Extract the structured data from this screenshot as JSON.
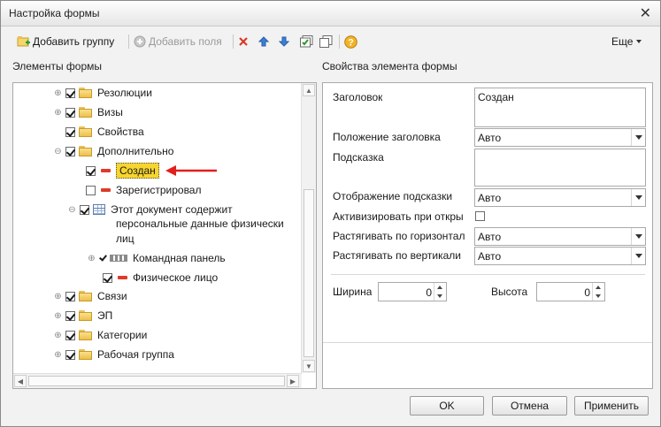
{
  "window": {
    "title": "Настройка формы",
    "close_glyph": "✕"
  },
  "toolbar": {
    "add_group": "Добавить группу",
    "add_fields": "Добавить поля",
    "more": "Еще",
    "icons": [
      "add-group-icon",
      "add-fields-icon",
      "delete-icon",
      "move-up-icon",
      "move-down-icon",
      "check-all-icon",
      "copy-icon",
      "help-icon"
    ]
  },
  "left_panel": {
    "title": "Элементы формы"
  },
  "right_panel": {
    "title": "Свойства элемента формы"
  },
  "tree": {
    "items": [
      {
        "label": "Резолюции",
        "checked": true
      },
      {
        "label": "Визы",
        "checked": true
      },
      {
        "label": "Свойства",
        "checked": true
      },
      {
        "label": "Дополнительно",
        "checked": true
      },
      {
        "label": "Создан",
        "checked": true,
        "selected": true
      },
      {
        "label": "Зарегистрировал",
        "checked": false
      },
      {
        "label": "Этот документ содержит",
        "label2": "персональные данные физически",
        "label3": "лиц",
        "checked": true
      },
      {
        "label": "Командная панель",
        "checked": true
      },
      {
        "label": "Физическое лицо",
        "checked": true
      },
      {
        "label": "Связи",
        "checked": true
      },
      {
        "label": "ЭП",
        "checked": true
      },
      {
        "label": "Категории",
        "checked": true
      },
      {
        "label": "Рабочая группа",
        "checked": true
      }
    ]
  },
  "properties": {
    "title_label": "Заголовок",
    "title_value": "Создан",
    "title_pos_label": "Положение заголовка",
    "title_pos_value": "Авто",
    "hint_label": "Подсказка",
    "hint_value": "",
    "hint_display_label": "Отображение подсказки",
    "hint_display_value": "Авто",
    "activate_label": "Активизировать при откры",
    "activate_checked": false,
    "stretch_h_label": "Растягивать по горизонтал",
    "stretch_h_value": "Авто",
    "stretch_v_label": "Растягивать по вертикали",
    "stretch_v_value": "Авто",
    "width_label": "Ширина",
    "width_value": "0",
    "height_label": "Высота",
    "height_value": "0"
  },
  "buttons": {
    "ok": "OK",
    "cancel": "Отмена",
    "apply": "Применить"
  },
  "colors": {
    "selection": "#f7d52e",
    "arrow": "#e0201a",
    "delete": "#d83a2a",
    "arrows_blue": "#3b7fd6"
  }
}
